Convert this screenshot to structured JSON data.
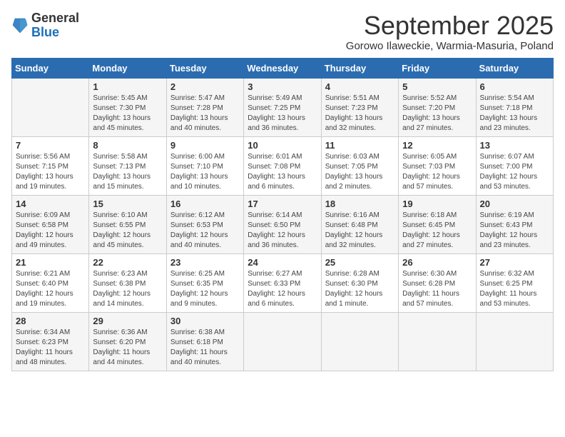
{
  "logo": {
    "general": "General",
    "blue": "Blue"
  },
  "header": {
    "month": "September 2025",
    "location": "Gorowo Ilaweckie, Warmia-Masuria, Poland"
  },
  "days_of_week": [
    "Sunday",
    "Monday",
    "Tuesday",
    "Wednesday",
    "Thursday",
    "Friday",
    "Saturday"
  ],
  "weeks": [
    [
      {
        "day": "",
        "info": ""
      },
      {
        "day": "1",
        "info": "Sunrise: 5:45 AM\nSunset: 7:30 PM\nDaylight: 13 hours\nand 45 minutes."
      },
      {
        "day": "2",
        "info": "Sunrise: 5:47 AM\nSunset: 7:28 PM\nDaylight: 13 hours\nand 40 minutes."
      },
      {
        "day": "3",
        "info": "Sunrise: 5:49 AM\nSunset: 7:25 PM\nDaylight: 13 hours\nand 36 minutes."
      },
      {
        "day": "4",
        "info": "Sunrise: 5:51 AM\nSunset: 7:23 PM\nDaylight: 13 hours\nand 32 minutes."
      },
      {
        "day": "5",
        "info": "Sunrise: 5:52 AM\nSunset: 7:20 PM\nDaylight: 13 hours\nand 27 minutes."
      },
      {
        "day": "6",
        "info": "Sunrise: 5:54 AM\nSunset: 7:18 PM\nDaylight: 13 hours\nand 23 minutes."
      }
    ],
    [
      {
        "day": "7",
        "info": "Sunrise: 5:56 AM\nSunset: 7:15 PM\nDaylight: 13 hours\nand 19 minutes."
      },
      {
        "day": "8",
        "info": "Sunrise: 5:58 AM\nSunset: 7:13 PM\nDaylight: 13 hours\nand 15 minutes."
      },
      {
        "day": "9",
        "info": "Sunrise: 6:00 AM\nSunset: 7:10 PM\nDaylight: 13 hours\nand 10 minutes."
      },
      {
        "day": "10",
        "info": "Sunrise: 6:01 AM\nSunset: 7:08 PM\nDaylight: 13 hours\nand 6 minutes."
      },
      {
        "day": "11",
        "info": "Sunrise: 6:03 AM\nSunset: 7:05 PM\nDaylight: 13 hours\nand 2 minutes."
      },
      {
        "day": "12",
        "info": "Sunrise: 6:05 AM\nSunset: 7:03 PM\nDaylight: 12 hours\nand 57 minutes."
      },
      {
        "day": "13",
        "info": "Sunrise: 6:07 AM\nSunset: 7:00 PM\nDaylight: 12 hours\nand 53 minutes."
      }
    ],
    [
      {
        "day": "14",
        "info": "Sunrise: 6:09 AM\nSunset: 6:58 PM\nDaylight: 12 hours\nand 49 minutes."
      },
      {
        "day": "15",
        "info": "Sunrise: 6:10 AM\nSunset: 6:55 PM\nDaylight: 12 hours\nand 45 minutes."
      },
      {
        "day": "16",
        "info": "Sunrise: 6:12 AM\nSunset: 6:53 PM\nDaylight: 12 hours\nand 40 minutes."
      },
      {
        "day": "17",
        "info": "Sunrise: 6:14 AM\nSunset: 6:50 PM\nDaylight: 12 hours\nand 36 minutes."
      },
      {
        "day": "18",
        "info": "Sunrise: 6:16 AM\nSunset: 6:48 PM\nDaylight: 12 hours\nand 32 minutes."
      },
      {
        "day": "19",
        "info": "Sunrise: 6:18 AM\nSunset: 6:45 PM\nDaylight: 12 hours\nand 27 minutes."
      },
      {
        "day": "20",
        "info": "Sunrise: 6:19 AM\nSunset: 6:43 PM\nDaylight: 12 hours\nand 23 minutes."
      }
    ],
    [
      {
        "day": "21",
        "info": "Sunrise: 6:21 AM\nSunset: 6:40 PM\nDaylight: 12 hours\nand 19 minutes."
      },
      {
        "day": "22",
        "info": "Sunrise: 6:23 AM\nSunset: 6:38 PM\nDaylight: 12 hours\nand 14 minutes."
      },
      {
        "day": "23",
        "info": "Sunrise: 6:25 AM\nSunset: 6:35 PM\nDaylight: 12 hours\nand 9 minutes."
      },
      {
        "day": "24",
        "info": "Sunrise: 6:27 AM\nSunset: 6:33 PM\nDaylight: 12 hours\nand 6 minutes."
      },
      {
        "day": "25",
        "info": "Sunrise: 6:28 AM\nSunset: 6:30 PM\nDaylight: 12 hours\nand 1 minute."
      },
      {
        "day": "26",
        "info": "Sunrise: 6:30 AM\nSunset: 6:28 PM\nDaylight: 11 hours\nand 57 minutes."
      },
      {
        "day": "27",
        "info": "Sunrise: 6:32 AM\nSunset: 6:25 PM\nDaylight: 11 hours\nand 53 minutes."
      }
    ],
    [
      {
        "day": "28",
        "info": "Sunrise: 6:34 AM\nSunset: 6:23 PM\nDaylight: 11 hours\nand 48 minutes."
      },
      {
        "day": "29",
        "info": "Sunrise: 6:36 AM\nSunset: 6:20 PM\nDaylight: 11 hours\nand 44 minutes."
      },
      {
        "day": "30",
        "info": "Sunrise: 6:38 AM\nSunset: 6:18 PM\nDaylight: 11 hours\nand 40 minutes."
      },
      {
        "day": "",
        "info": ""
      },
      {
        "day": "",
        "info": ""
      },
      {
        "day": "",
        "info": ""
      },
      {
        "day": "",
        "info": ""
      }
    ]
  ]
}
